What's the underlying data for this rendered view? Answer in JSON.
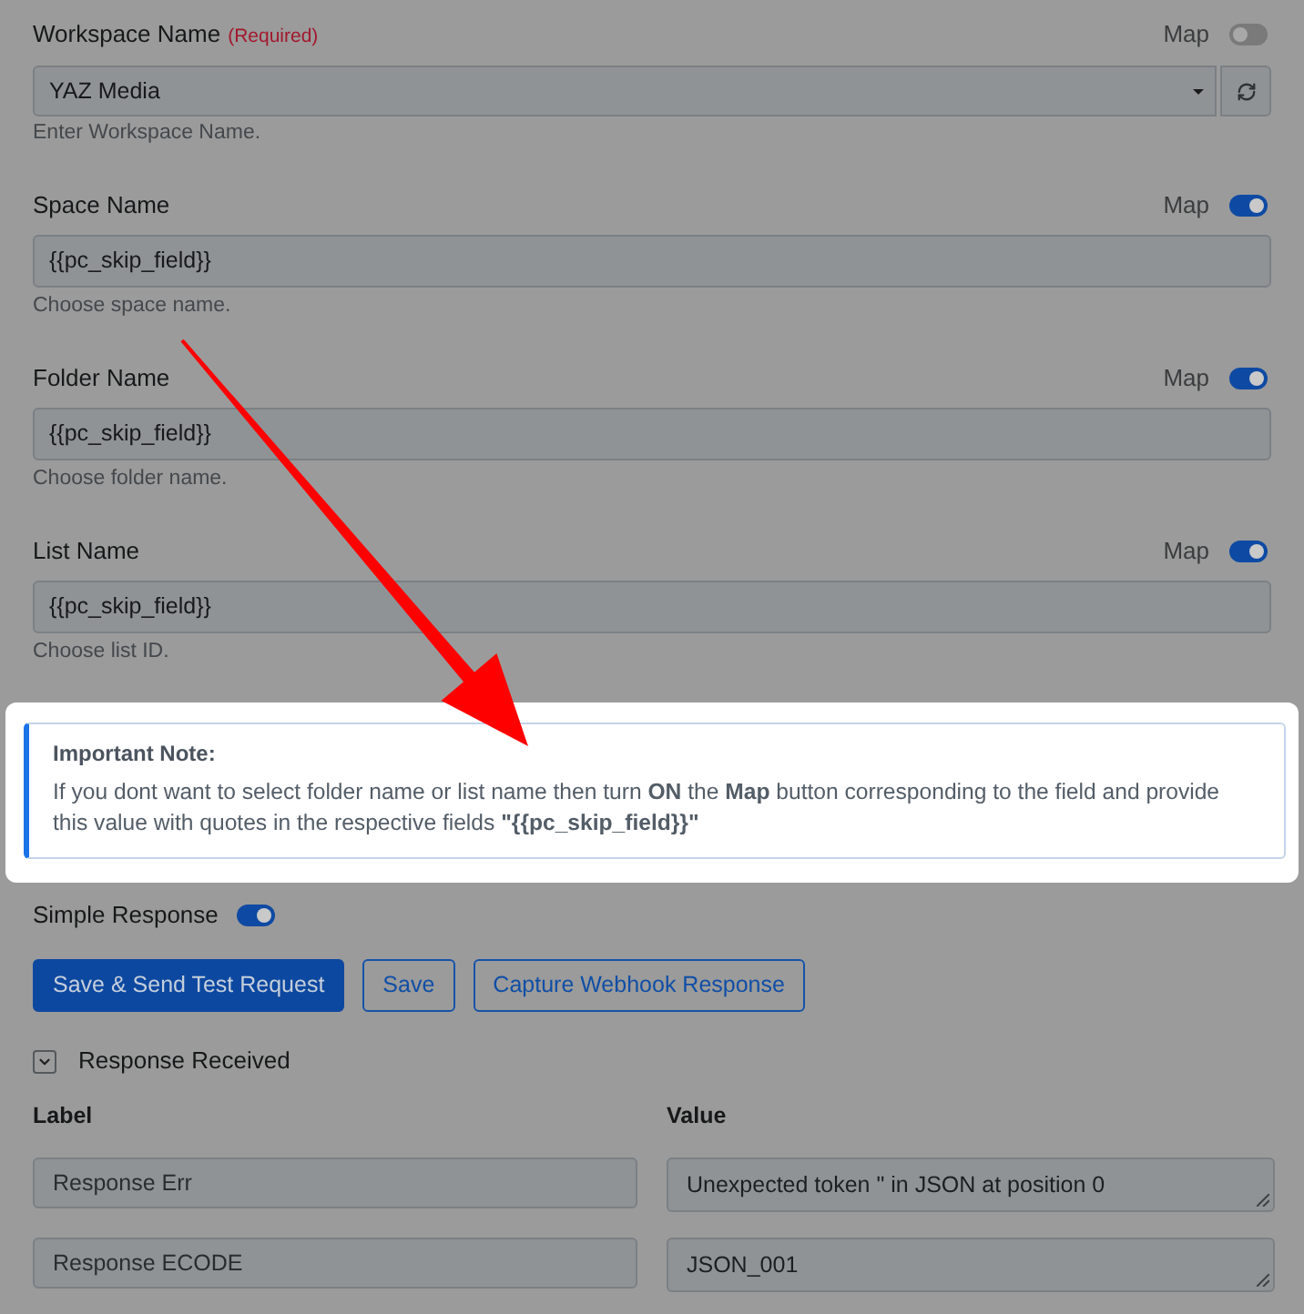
{
  "fields": [
    {
      "kind": "select",
      "label": "Workspace Name",
      "required": "(Required)",
      "map": {
        "label": "Map",
        "on": false
      },
      "value": "YAZ Media",
      "hint": "Enter Workspace Name."
    },
    {
      "kind": "text",
      "label": "Space Name",
      "map": {
        "label": "Map",
        "on": true
      },
      "value": "{{pc_skip_field}}",
      "hint": "Choose space name."
    },
    {
      "kind": "text",
      "label": "Folder Name",
      "map": {
        "label": "Map",
        "on": true
      },
      "value": "{{pc_skip_field}}",
      "hint": "Choose folder name."
    },
    {
      "kind": "text",
      "label": "List Name",
      "map": {
        "label": "Map",
        "on": true
      },
      "value": "{{pc_skip_field}}",
      "hint": "Choose list ID."
    }
  ],
  "note": {
    "title": "Important Note:",
    "body": "If you dont want to select folder name or list name then turn **ON** the **Map** button corresponding to the field and provide this value with quotes in the respective fields **\"{{pc_skip_field}}\"**"
  },
  "simple_response": {
    "label": "Simple Response",
    "on": true
  },
  "buttons": [
    {
      "label": "Save & Send Test Request",
      "kind": "primary"
    },
    {
      "label": "Save",
      "kind": "outline"
    },
    {
      "label": "Capture Webhook Response",
      "kind": "outline"
    }
  ],
  "response": {
    "label": "Response Received",
    "expanded": true,
    "columns": [
      "Label",
      "Value"
    ],
    "rows": [
      {
        "label": "Response Err",
        "value": "Unexpected token \" in JSON at position 0"
      },
      {
        "label": "Response ECODE",
        "value": "JSON_001"
      }
    ]
  }
}
